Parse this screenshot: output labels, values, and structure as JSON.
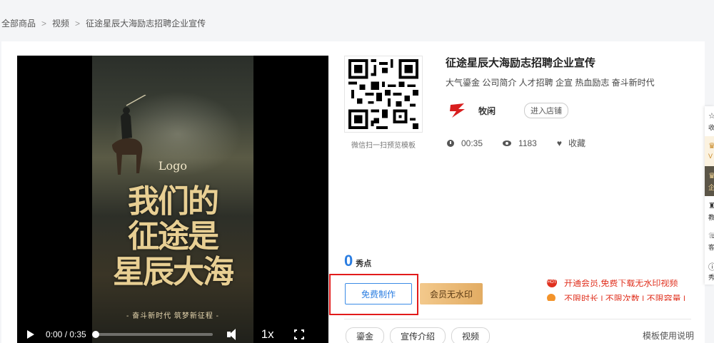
{
  "breadcrumb": [
    "全部商品",
    "视频",
    "征途星辰大海励志招聘企业宣传"
  ],
  "video": {
    "poster_logo": "Logo",
    "poster_lines": [
      "我们的",
      "征途是",
      "星辰大海"
    ],
    "poster_slogan": "- 奋斗新时代  筑梦新征程 -",
    "time": "0:00 / 0:35",
    "progress": 0.0,
    "speed": "1x"
  },
  "qr_caption": "微信扫一扫预览模板",
  "product": {
    "title": "征途星辰大海励志招聘企业宣传",
    "tags": "大气鎏金 公司简介 人才招聘 企宣 热血励志 奋斗新时代",
    "author": "牧闲",
    "shop_button": "进入店铺",
    "duration": "00:35",
    "views": "1183",
    "favorite_label": "收藏"
  },
  "points": {
    "value": "0",
    "unit": "秀点"
  },
  "buttons": {
    "free_make": "免费制作",
    "vip_no_watermark": "会员无水印"
  },
  "promo": {
    "line1": "开通会员,免费下载无水印视频",
    "line2": "不限时长 | 不限次数 | 不限容量 |"
  },
  "chips": [
    "鎏金",
    "宣传介绍",
    "视频"
  ],
  "usage_link": "模板使用说明",
  "float_bar": [
    "收",
    "V",
    "企",
    "教",
    "客",
    "秀"
  ],
  "colors": {
    "accent_blue": "#2a7de1",
    "highlight_red": "#e21b1b",
    "vip_gold": "#e2ac63"
  }
}
